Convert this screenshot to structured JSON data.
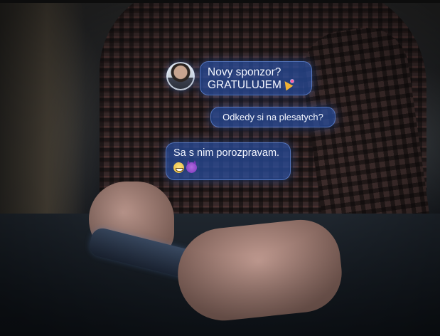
{
  "scene": {
    "description_icons": [
      "avatar",
      "party-popper-icon",
      "grinning-face-icon",
      "smiling-devil-icon"
    ]
  },
  "chat": {
    "messages": [
      {
        "lines": [
          "Novy sponzor?",
          "GRATULUJEM"
        ],
        "has_avatar": true,
        "emoji": [
          "party-popper"
        ]
      },
      {
        "lines": [
          "Odkedy si na plesatych?"
        ],
        "has_avatar": false,
        "emoji": []
      },
      {
        "lines": [
          "Sa s nim porozpravam."
        ],
        "has_avatar": false,
        "emoji": [
          "grinning-face",
          "smiling-devil"
        ]
      }
    ]
  },
  "colors": {
    "bubble": "#284ea0",
    "bubble_text": "#f3f6ff"
  }
}
